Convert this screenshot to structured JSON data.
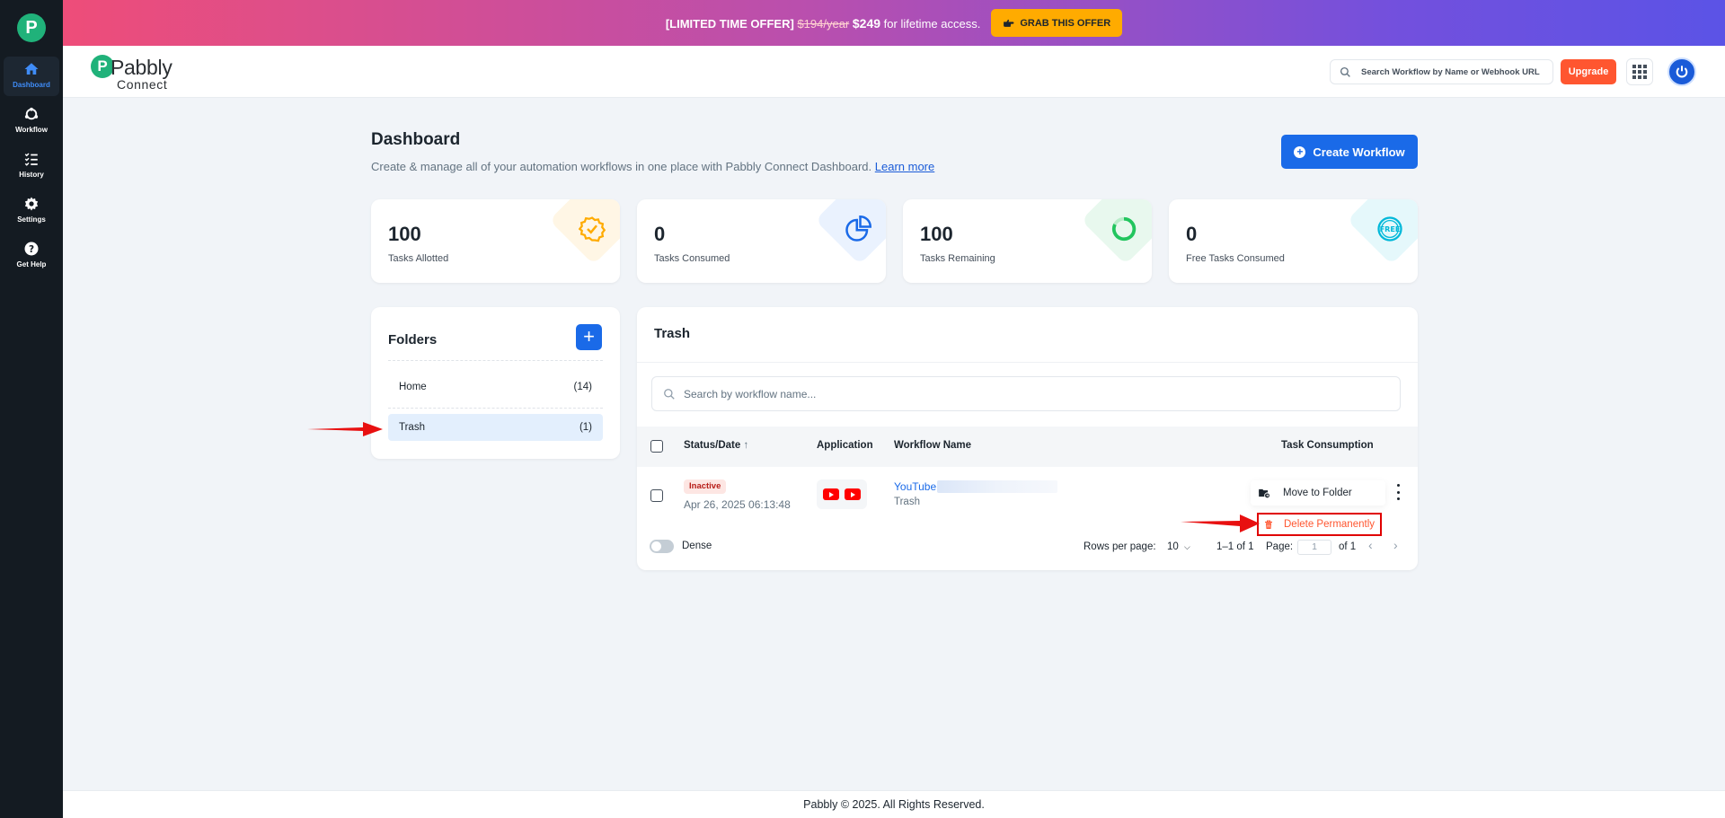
{
  "sidebar": {
    "logo_letter": "P",
    "items": [
      {
        "label": "Dashboard",
        "icon": "home-icon"
      },
      {
        "label": "Workflow",
        "icon": "workflow-icon"
      },
      {
        "label": "History",
        "icon": "history-icon"
      },
      {
        "label": "Settings",
        "icon": "gear-icon"
      },
      {
        "label": "Get Help",
        "icon": "help-icon"
      }
    ]
  },
  "banner": {
    "prefix": "[LIMITED TIME OFFER]",
    "old_price": "$194/year",
    "new_price": "$249",
    "suffix": "for lifetime access.",
    "button": "GRAB THIS OFFER"
  },
  "header": {
    "brand_name": "Pabbly",
    "brand_sub": "Connect",
    "search_placeholder": "Search Workflow by Name or Webhook URL",
    "upgrade": "Upgrade"
  },
  "page": {
    "title": "Dashboard",
    "subtitle": "Create & manage all of your automation workflows in one place with Pabbly Connect Dashboard.",
    "learn_more": "Learn more",
    "create_button": "Create Workflow"
  },
  "stats": [
    {
      "value": "100",
      "label": "Tasks Allotted",
      "color": "#ffab00"
    },
    {
      "value": "0",
      "label": "Tasks Consumed",
      "color": "#1a6ae8"
    },
    {
      "value": "100",
      "label": "Tasks Remaining",
      "color": "#22c55e"
    },
    {
      "value": "0",
      "label": "Free Tasks Consumed",
      "color": "#00b8d9"
    }
  ],
  "folders": {
    "title": "Folders",
    "items": [
      {
        "name": "Home",
        "count": "(14)"
      },
      {
        "name": "Trash",
        "count": "(1)"
      }
    ]
  },
  "trash": {
    "title": "Trash",
    "search_placeholder": "Search by workflow name...",
    "columns": [
      "Status/Date",
      "Application",
      "Workflow Name",
      "Task Consumption"
    ],
    "row": {
      "status": "Inactive",
      "date": "Apr 26, 2025 06:13:48",
      "workflow_name": "YouTube",
      "folder": "Trash"
    },
    "menu": {
      "move": "Move to Folder",
      "delete": "Delete Permanently"
    },
    "dense_label": "Dense",
    "rows_per_page_label": "Rows per page:",
    "rows_per_page": "10",
    "range": "1–1 of 1",
    "page_label": "Page:",
    "page_value": "1",
    "page_of": "of 1"
  },
  "footer": "Pabbly © 2025. All Rights Reserved."
}
